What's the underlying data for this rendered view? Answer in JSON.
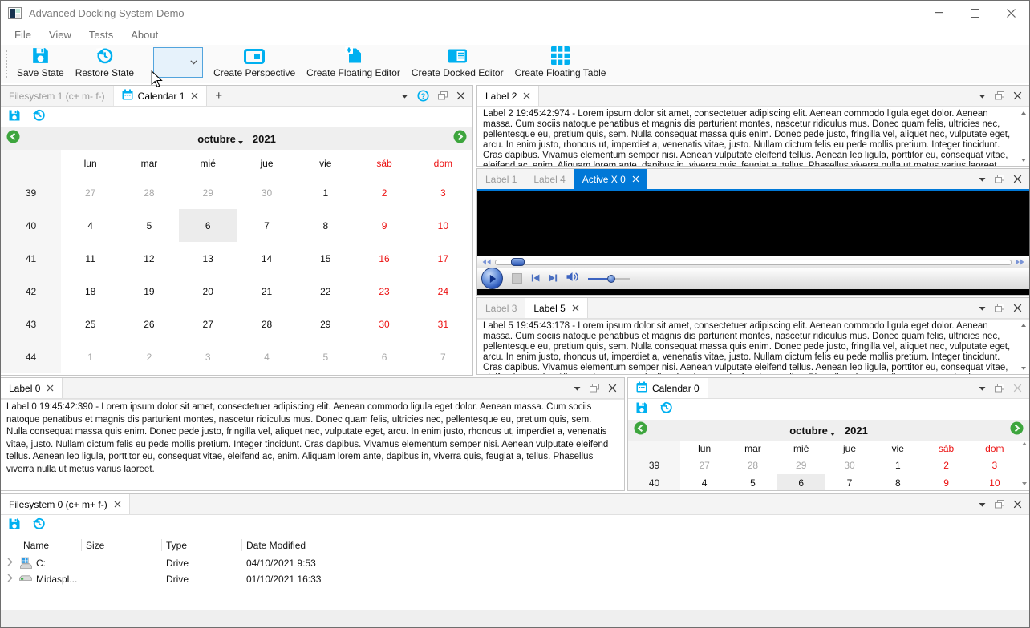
{
  "window": {
    "title": "Advanced Docking System Demo"
  },
  "titlebar_controls": [
    "minimize",
    "maximize",
    "close"
  ],
  "menu": [
    "File",
    "View",
    "Tests",
    "About"
  ],
  "toolbar": [
    {
      "type": "button",
      "icon": "save-icon",
      "label": "Save State"
    },
    {
      "type": "button",
      "icon": "restore-icon",
      "label": "Restore State"
    },
    {
      "type": "separator"
    },
    {
      "type": "combo",
      "value": "",
      "state": "hovered"
    },
    {
      "type": "button",
      "icon": "create-perspective-icon",
      "label": "Create Perspective"
    },
    {
      "type": "button",
      "icon": "create-floating-editor-icon",
      "label": "Create Floating Editor"
    },
    {
      "type": "button",
      "icon": "create-docked-editor-icon",
      "label": "Create Docked Editor"
    },
    {
      "type": "button",
      "icon": "create-floating-table-icon",
      "label": "Create Floating Table"
    }
  ],
  "colors": {
    "accent_cyan": "#00b0f0",
    "active_tab_blue": "#0078d7",
    "weekend_red": "#ec1212",
    "muted_day": "#a8a8a8"
  },
  "lorem_text": "Lorem ipsum dolor sit amet, consectetuer adipiscing elit. Aenean commodo ligula eget dolor. Aenean massa. Cum sociis natoque penatibus et magnis dis parturient montes, nascetur ridiculus mus. Donec quam felis, ultricies nec, pellentesque eu, pretium quis, sem. Nulla consequat massa quis enim. Donec pede justo, fringilla vel, aliquet nec, vulputate eget, arcu. In enim justo, rhoncus ut, imperdiet a, venenatis vitae, justo. Nullam dictum felis eu pede mollis pretium. Integer tincidunt. Cras dapibus. Vivamus elementum semper nisi. Aenean vulputate eleifend tellus. Aenean leo ligula, porttitor eu, consequat vitae, eleifend ac, enim. Aliquam lorem ante, dapibus in, viverra quis, feugiat a, tellus. Phasellus viverra nulla ut metus varius laoreet.",
  "panels": {
    "dock_left": {
      "tabs": [
        {
          "label": "Filesystem 1 (c+ m- f-)"
        },
        {
          "label": "Calendar 1",
          "icon": "calendar-icon",
          "active": true,
          "closable": true
        }
      ],
      "add_button": "+",
      "header_buttons": [
        "dropdown",
        "help",
        "undock",
        "close"
      ]
    },
    "label2": {
      "tabs": [
        {
          "label": "Label 2",
          "active": true,
          "closable": true
        }
      ],
      "header_buttons": [
        "dropdown",
        "undock",
        "close"
      ],
      "text_prefix": "Label 2 19:45:42:974 - "
    },
    "activex": {
      "tabs": [
        {
          "label": "Label 1"
        },
        {
          "label": "Label 4"
        },
        {
          "label": "Active X 0",
          "active": true,
          "closable": true,
          "highlighted": true
        }
      ],
      "header_buttons": [
        "dropdown",
        "undock",
        "close"
      ]
    },
    "label5": {
      "tabs": [
        {
          "label": "Label 3"
        },
        {
          "label": "Label 5",
          "active": true,
          "closable": true
        }
      ],
      "header_buttons": [
        "dropdown",
        "undock",
        "close"
      ],
      "text_prefix": "Label 5 19:45:43:178 - "
    },
    "label0": {
      "tabs": [
        {
          "label": "Label 0",
          "active": true,
          "closable": true
        }
      ],
      "header_buttons": [
        "dropdown",
        "undock",
        "close"
      ],
      "text_prefix": "Label 0 19:45:42:390 - "
    },
    "calendar0": {
      "tabs": [
        {
          "label": "Calendar 0",
          "icon": "calendar-icon",
          "active": true
        }
      ],
      "header_buttons": [
        "dropdown",
        "undock",
        "close-disabled"
      ]
    },
    "filesystem0": {
      "tabs": [
        {
          "label": "Filesystem 0 (c+ m+ f-)",
          "active": true,
          "closable": true
        }
      ],
      "header_buttons": [
        "dropdown",
        "undock",
        "close"
      ]
    }
  },
  "calendar": {
    "month": "octubre",
    "year": "2021",
    "day_headers": [
      "lun",
      "mar",
      "mié",
      "jue",
      "vie",
      "sáb",
      "dom"
    ],
    "weekend_headers": [
      "sáb",
      "dom"
    ],
    "weeks": [
      {
        "week": "39",
        "days": [
          {
            "d": "27",
            "muted": true
          },
          {
            "d": "28",
            "muted": true
          },
          {
            "d": "29",
            "muted": true
          },
          {
            "d": "30",
            "muted": true
          },
          {
            "d": "1"
          },
          {
            "d": "2",
            "weekend": true
          },
          {
            "d": "3",
            "weekend": true
          }
        ]
      },
      {
        "week": "40",
        "days": [
          {
            "d": "4"
          },
          {
            "d": "5"
          },
          {
            "d": "6",
            "selected": true
          },
          {
            "d": "7"
          },
          {
            "d": "8"
          },
          {
            "d": "9",
            "weekend": true
          },
          {
            "d": "10",
            "weekend": true
          }
        ]
      },
      {
        "week": "41",
        "days": [
          {
            "d": "11"
          },
          {
            "d": "12"
          },
          {
            "d": "13"
          },
          {
            "d": "14"
          },
          {
            "d": "15"
          },
          {
            "d": "16",
            "weekend": true
          },
          {
            "d": "17",
            "weekend": true
          }
        ]
      },
      {
        "week": "42",
        "days": [
          {
            "d": "18"
          },
          {
            "d": "19"
          },
          {
            "d": "20"
          },
          {
            "d": "21"
          },
          {
            "d": "22"
          },
          {
            "d": "23",
            "weekend": true
          },
          {
            "d": "24",
            "weekend": true
          }
        ]
      },
      {
        "week": "43",
        "days": [
          {
            "d": "25"
          },
          {
            "d": "26"
          },
          {
            "d": "27"
          },
          {
            "d": "28"
          },
          {
            "d": "29"
          },
          {
            "d": "30",
            "weekend": true
          },
          {
            "d": "31",
            "weekend": true
          }
        ]
      },
      {
        "week": "44",
        "days": [
          {
            "d": "1",
            "muted": true
          },
          {
            "d": "2",
            "muted": true
          },
          {
            "d": "3",
            "muted": true
          },
          {
            "d": "4",
            "muted": true
          },
          {
            "d": "5",
            "muted": true
          },
          {
            "d": "6",
            "muted": true
          },
          {
            "d": "7",
            "muted": true
          }
        ]
      }
    ],
    "calendar0_visible_weeks": 2
  },
  "media_player": {
    "controls": [
      "rewind",
      "seek-slider",
      "fast-forward",
      "play",
      "stop",
      "previous",
      "next",
      "mute",
      "volume-slider"
    ],
    "seek_pct": 3,
    "volume_pct": 46
  },
  "filesystem": {
    "columns": [
      "Name",
      "Size",
      "Type",
      "Date Modified"
    ],
    "rows": [
      {
        "icon": "drive-windows-icon",
        "name": "C:",
        "size": "",
        "type": "Drive",
        "date_modified": "04/10/2021 9:53"
      },
      {
        "icon": "drive-network-icon",
        "name": "Midaspl...",
        "size": "",
        "type": "Drive",
        "date_modified": "01/10/2021 16:33"
      }
    ]
  },
  "statusbar": {
    "text": ""
  }
}
